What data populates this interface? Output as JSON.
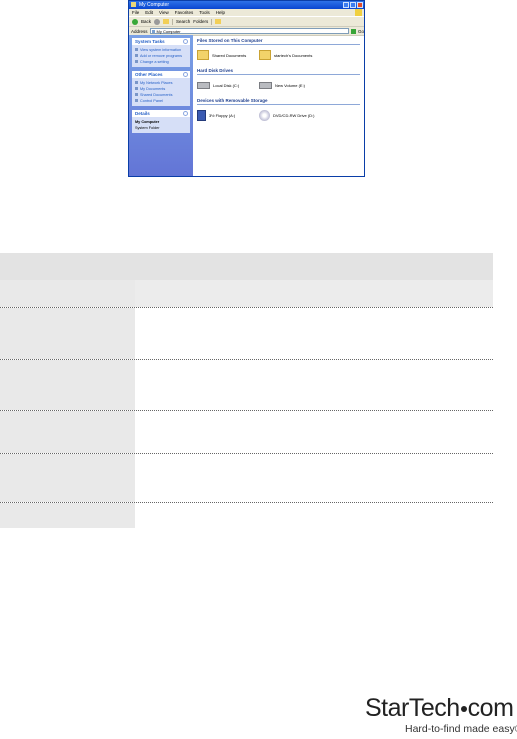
{
  "window": {
    "title": "My Computer",
    "menu": [
      "File",
      "Edit",
      "View",
      "Favorites",
      "Tools",
      "Help"
    ],
    "toolbar": {
      "back": "Back",
      "search": "Search",
      "folders": "Folders"
    },
    "address": {
      "label": "Address",
      "value": "My Computer",
      "go": "Go"
    },
    "left_panes": {
      "system_tasks": {
        "title": "System Tasks",
        "items": [
          "View system information",
          "Add or remove programs",
          "Change a setting"
        ]
      },
      "other_places": {
        "title": "Other Places",
        "items": [
          "My Network Places",
          "My Documents",
          "Shared Documents",
          "Control Panel"
        ]
      },
      "details": {
        "title": "Details",
        "lines": [
          "My Computer",
          "System Folder"
        ]
      }
    },
    "groups": [
      {
        "title": "Files Stored on This Computer",
        "items": [
          "Shared Documents",
          "startech's Documents"
        ]
      },
      {
        "title": "Hard Disk Drives",
        "items": [
          "Local Disk (C:)",
          "New Volume (E:)"
        ]
      },
      {
        "title": "Devices with Removable Storage",
        "items": [
          "3½ Floppy (A:)",
          "DVD/CD-RW Drive (D:)"
        ]
      }
    ]
  },
  "brand": {
    "name_left": "StarTech",
    "name_right": "com",
    "tagline": "Hard-to-find made easy®"
  }
}
